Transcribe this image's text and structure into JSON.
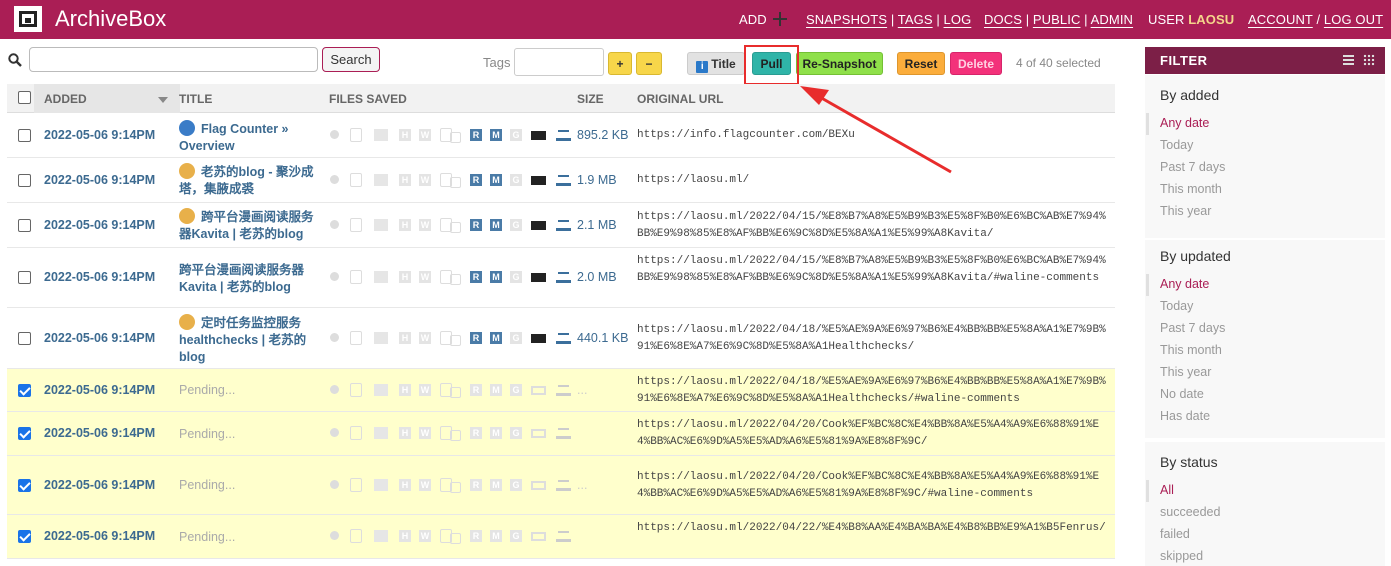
{
  "header": {
    "brand": "ArchiveBox",
    "add": "ADD",
    "snapshots": "SNAPSHOTS",
    "tags": "TAGS",
    "log": "LOG",
    "docs": "DOCS",
    "public": "PUBLIC",
    "admin": "ADMIN",
    "user_label": "USER",
    "username": "LAOSU",
    "account": "ACCOUNT",
    "logout": "LOG OUT",
    "sep": "|",
    "slash": "/"
  },
  "toolbar": {
    "search_button": "Search",
    "search_value": "",
    "tags_label": "Tags",
    "tag_add": "+",
    "tag_remove": "−",
    "title_button": "Title",
    "title_icon": "i",
    "pull_button": "Pull",
    "resnapshot_button": "Re-Snapshot",
    "reset_button": "Reset",
    "delete_button": "Delete",
    "selected_count": "4 of 40 selected"
  },
  "table": {
    "headers": {
      "added": "ADDED",
      "title": "TITLE",
      "files": "FILES SAVED",
      "size": "SIZE",
      "url": "ORIGINAL URL"
    },
    "rows": [
      {
        "added": "2022-05-06 9:14PM",
        "title": "Flag Counter » Overview",
        "size": "895.2 KB",
        "url": "https://info.flagcounter.com/BEXu",
        "checked": false,
        "pending": false
      },
      {
        "added": "2022-05-06 9:14PM",
        "title": "老苏的blog - 聚沙成塔，集腋成裘",
        "size": "1.9 MB",
        "url": "https://laosu.ml/",
        "checked": false,
        "pending": false
      },
      {
        "added": "2022-05-06 9:14PM",
        "title": "跨平台漫画阅读服务器Kavita | 老苏的blog",
        "size": "2.1 MB",
        "url": "https://laosu.ml/2022/04/15/%E8%B7%A8%E5%B9%B3%E5%8F%B0%E6%BC%AB%E7%94%BB%E9%98%85%E8%AF%BB%E6%9C%8D%E5%8A%A1%E5%99%A8Kavita/",
        "checked": false,
        "pending": false
      },
      {
        "added": "2022-05-06 9:14PM",
        "title": "跨平台漫画阅读服务器Kavita | 老苏的blog",
        "size": "2.0 MB",
        "url": "https://laosu.ml/2022/04/15/%E8%B7%A8%E5%B9%B3%E5%8F%B0%E6%BC%AB%E7%94%BB%E9%98%85%E8%AF%BB%E6%9C%8D%E5%8A%A1%E5%99%A8Kavita/#waline-comments",
        "checked": false,
        "pending": false
      },
      {
        "added": "2022-05-06 9:14PM",
        "title": "定时任务监控服务healthchecks | 老苏的blog",
        "size": "440.1 KB",
        "url": "https://laosu.ml/2022/04/18/%E5%AE%9A%E6%97%B6%E4%BB%BB%E5%8A%A1%E7%9B%91%E6%8E%A7%E6%9C%8D%E5%8A%A1Healthchecks/",
        "checked": false,
        "pending": false
      },
      {
        "added": "2022-05-06 9:14PM",
        "title": "Pending...",
        "size": "...",
        "url": "https://laosu.ml/2022/04/18/%E5%AE%9A%E6%97%B6%E4%BB%BB%E5%8A%A1%E7%9B%91%E6%8E%A7%E6%9C%8D%E5%8A%A1Healthchecks/#waline-comments",
        "checked": true,
        "pending": true
      },
      {
        "added": "2022-05-06 9:14PM",
        "title": "Pending...",
        "size": "",
        "url": "https://laosu.ml/2022/04/20/Cook%EF%BC%8C%E4%BB%8A%E5%A4%A9%E6%88%91%E4%BB%AC%E6%9D%A5%E5%AD%A6%E5%81%9A%E8%8F%9C/",
        "checked": true,
        "pending": true
      },
      {
        "added": "2022-05-06 9:14PM",
        "title": "Pending...",
        "size": "...",
        "url": "https://laosu.ml/2022/04/20/Cook%EF%BC%8C%E4%BB%8A%E5%A4%A9%E6%88%91%E4%BB%AC%E6%9D%A5%E5%AD%A6%E5%81%9A%E8%8F%9C/#waline-comments",
        "checked": true,
        "pending": true
      },
      {
        "added": "2022-05-06 9:14PM",
        "title": "Pending...",
        "size": "",
        "url": "https://laosu.ml/2022/04/22/%E4%B8%AA%E4%BA%BA%E4%B8%BB%E9%A1%B5Fenrus/",
        "checked": true,
        "pending": true
      }
    ]
  },
  "filter": {
    "title": "FILTER",
    "groups": [
      {
        "title": "By added",
        "items": [
          "Any date",
          "Today",
          "Past 7 days",
          "This month",
          "This year"
        ],
        "active": 0
      },
      {
        "title": "By updated",
        "items": [
          "Any date",
          "Today",
          "Past 7 days",
          "This month",
          "This year",
          "No date",
          "Has date"
        ],
        "active": 0
      },
      {
        "title": "By status",
        "items": [
          "All",
          "succeeded",
          "failed",
          "skipped"
        ],
        "active": 0
      }
    ]
  },
  "colors": {
    "brand": "#aa1e55",
    "filter_head": "#7c1f47",
    "selected_row": "#ffffcc",
    "annotation": "#e82c2c"
  },
  "icons": [
    "logo-icon",
    "add-plus-icon",
    "search-icon",
    "list-view-icon",
    "grid-view-icon",
    "favicon-icon",
    "annotation-arrow-icon"
  ]
}
